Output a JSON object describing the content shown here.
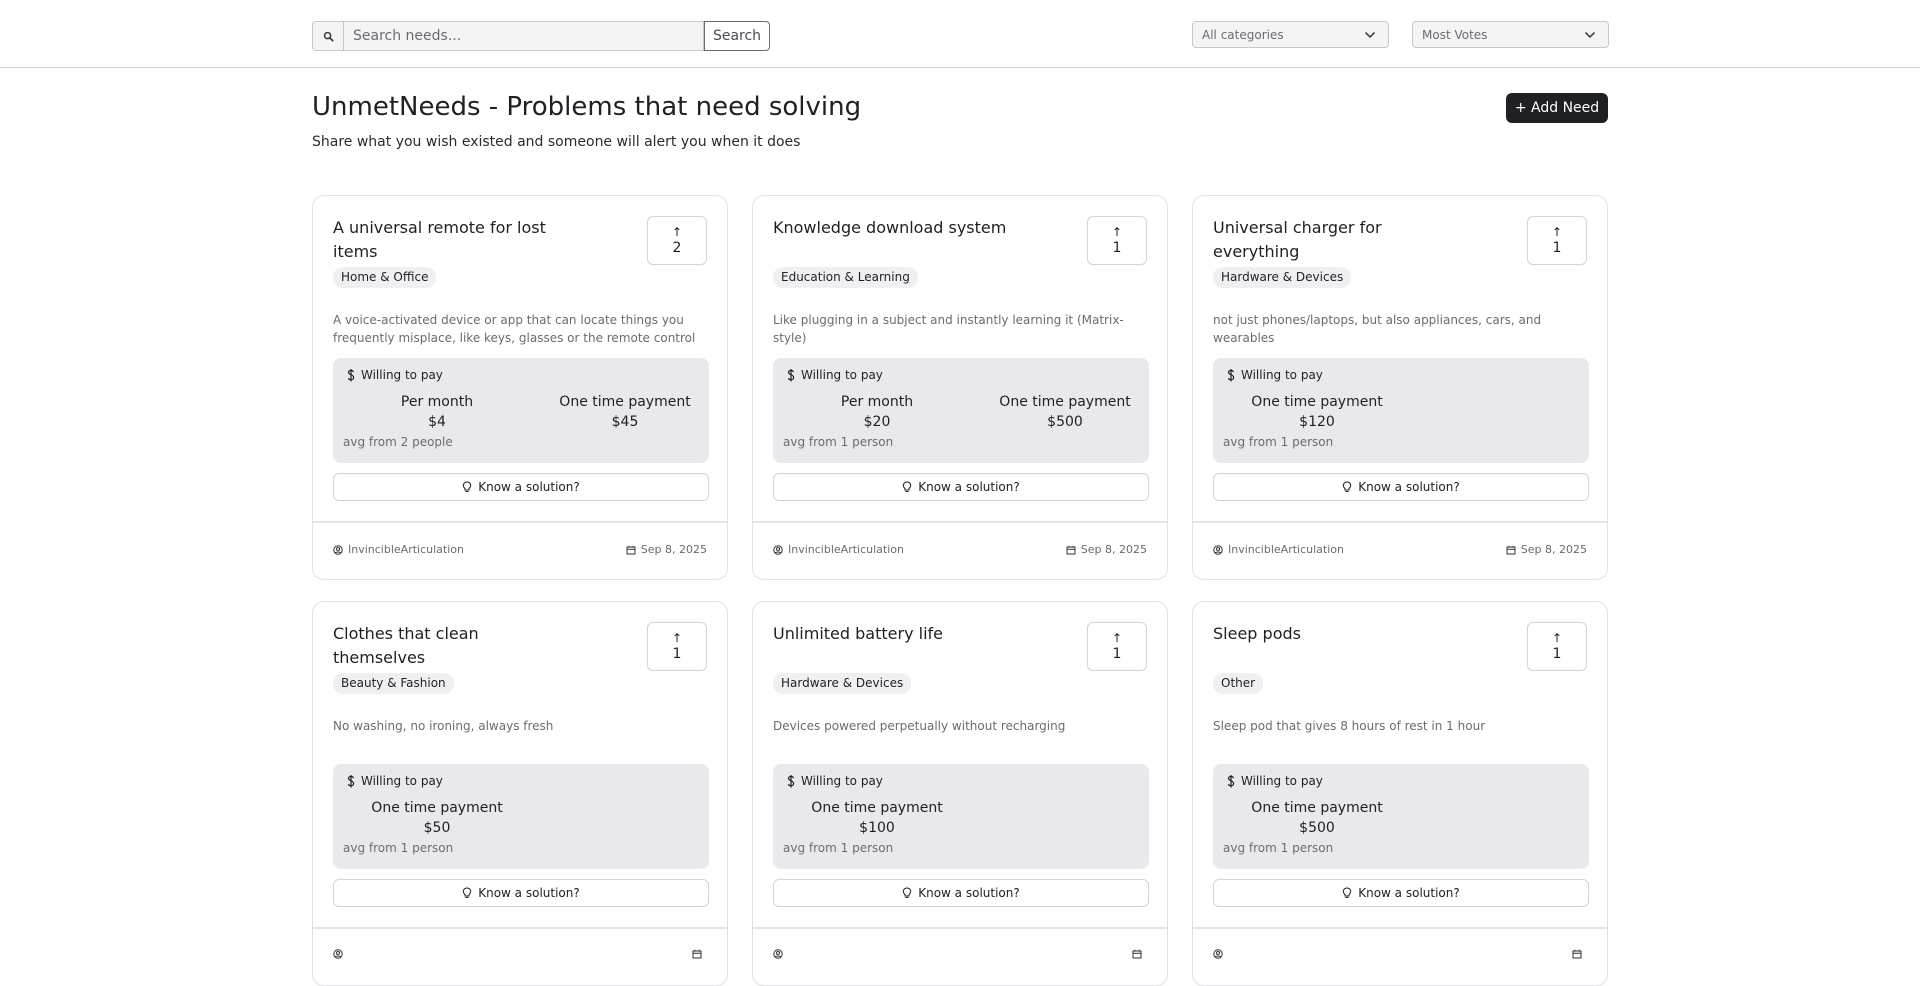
{
  "search": {
    "placeholder": "Search needs...",
    "value": "",
    "button_label": "Search"
  },
  "filters": {
    "category": "All categories",
    "sort": "Most Votes"
  },
  "header": {
    "title": "UnmetNeeds - Problems that need solving",
    "subtitle": "Share what you wish existed and someone will alert you when it does",
    "add_button": "+ Add Need"
  },
  "labels": {
    "willing_to_pay": "Willing to pay",
    "know_solution": "Know a solution?",
    "vote_arrow": "↑"
  },
  "cards": [
    {
      "title": "A universal remote for lost items",
      "votes": "2",
      "category": "Home & Office",
      "description": "A voice-activated device or app that can locate things you frequently misplace, like keys, glasses or the remote control",
      "payments": [
        {
          "label": "Per month",
          "amount": "$4"
        },
        {
          "label": "One time payment",
          "amount": "$45"
        }
      ],
      "avg": "avg from 2 people",
      "user": "InvincibleArticulation",
      "date": "Sep 8, 2025"
    },
    {
      "title": "Knowledge download system",
      "votes": "1",
      "category": "Education & Learning",
      "description": "Like plugging in a subject and instantly learning it (Matrix-style)",
      "payments": [
        {
          "label": "Per month",
          "amount": "$20"
        },
        {
          "label": "One time payment",
          "amount": "$500"
        }
      ],
      "avg": "avg from 1 person",
      "user": "InvincibleArticulation",
      "date": "Sep 8, 2025"
    },
    {
      "title": "Universal charger for everything",
      "votes": "1",
      "category": "Hardware & Devices",
      "description": "not just phones/laptops, but also appliances, cars, and wearables",
      "payments": [
        {
          "label": "One time payment",
          "amount": "$120"
        }
      ],
      "avg": "avg from 1 person",
      "user": "InvincibleArticulation",
      "date": "Sep 8, 2025"
    },
    {
      "title": "Clothes that clean themselves",
      "votes": "1",
      "category": "Beauty & Fashion",
      "description": "No washing, no ironing, always fresh",
      "payments": [
        {
          "label": "One time payment",
          "amount": "$50"
        }
      ],
      "avg": "avg from 1 person",
      "user": "",
      "date": ""
    },
    {
      "title": "Unlimited battery life",
      "votes": "1",
      "category": "Hardware & Devices",
      "description": "Devices powered perpetually without recharging",
      "payments": [
        {
          "label": "One time payment",
          "amount": "$100"
        }
      ],
      "avg": "avg from 1 person",
      "user": "",
      "date": ""
    },
    {
      "title": "Sleep pods",
      "votes": "1",
      "category": "Other",
      "description": "Sleep pod that gives 8 hours of rest in 1 hour",
      "payments": [
        {
          "label": "One time payment",
          "amount": "$500"
        }
      ],
      "avg": "avg from 1 person",
      "user": "",
      "date": ""
    }
  ]
}
